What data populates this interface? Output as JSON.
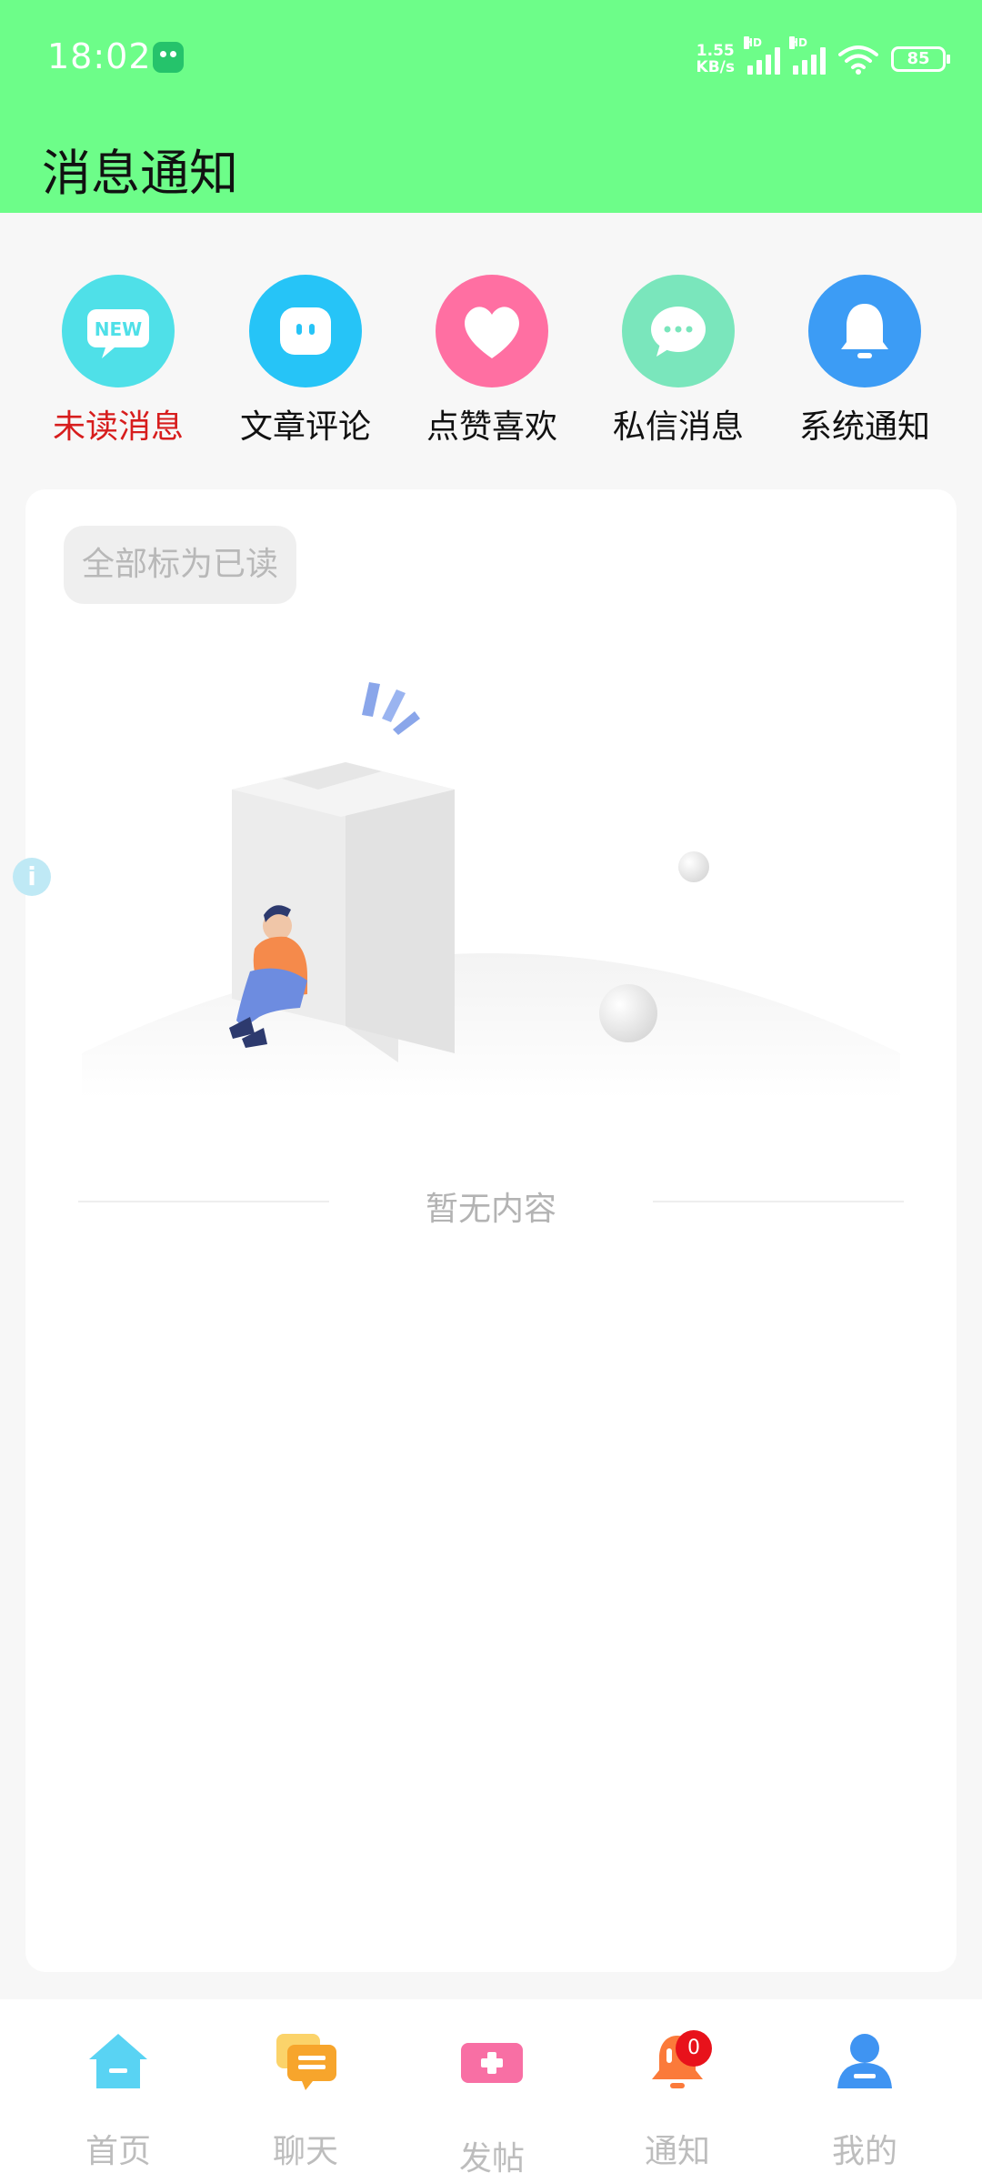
{
  "status": {
    "time": "18:02",
    "net_speed_value": "1.55",
    "net_speed_unit": "KB/s",
    "hd1": "HD",
    "hd2": "HD",
    "battery": "85"
  },
  "header": {
    "title": "消息通知"
  },
  "categories": [
    {
      "label": "未读消息",
      "icon": "new-icon",
      "color": "#4fe0e8",
      "active": true
    },
    {
      "label": "文章评论",
      "icon": "comment-icon",
      "color": "#26c4f7",
      "active": false
    },
    {
      "label": "点赞喜欢",
      "icon": "heart-icon",
      "color": "#ff6fa2",
      "active": false
    },
    {
      "label": "私信消息",
      "icon": "chat-icon",
      "color": "#7ae6bc",
      "active": false
    },
    {
      "label": "系统通知",
      "icon": "bell-icon",
      "color": "#3c9cf5",
      "active": false
    }
  ],
  "actions": {
    "mark_all_read": "全部标为已读"
  },
  "empty": {
    "text": "暂无内容"
  },
  "tabbar": {
    "items": [
      {
        "label": "首页",
        "icon": "home-icon",
        "color": "#59d3f3"
      },
      {
        "label": "聊天",
        "icon": "chat-bubbles-icon",
        "color": "#f7b12c"
      },
      {
        "label": "发帖",
        "icon": "add-post-icon",
        "color": "#f86fa4"
      },
      {
        "label": "通知",
        "icon": "bell-icon",
        "color": "#fb7a3a",
        "badge": "0"
      },
      {
        "label": "我的",
        "icon": "user-icon",
        "color": "#3f94f2"
      }
    ]
  }
}
